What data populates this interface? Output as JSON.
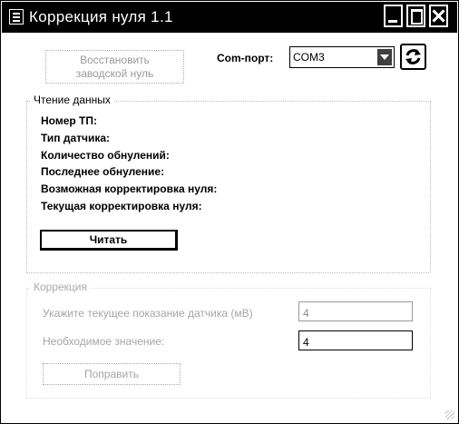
{
  "window": {
    "title": "Коррекция нуля 1.1"
  },
  "toolbar": {
    "restore_button": {
      "line1": "Восстановить",
      "line2": "заводской нуль"
    },
    "com_port": {
      "label": "Com-порт:",
      "value": "COM3"
    },
    "refresh_icon": "refresh-icon"
  },
  "read_group": {
    "title": "Чтение данных",
    "lines": [
      "Номер ТП:",
      "Тип датчика:",
      "Количество обнулений:",
      "Последнее обнуление:",
      "Возможная корректировка нуля:",
      "Текущая корректировка нуля:"
    ],
    "read_button": "Читать"
  },
  "correction_group": {
    "title": "Коррекция",
    "current_label": "Укажите текущее показание датчика (мВ)",
    "current_value": "4",
    "needed_label": "Необходимое значение:",
    "needed_value": "4",
    "fix_button": "Поправить"
  }
}
